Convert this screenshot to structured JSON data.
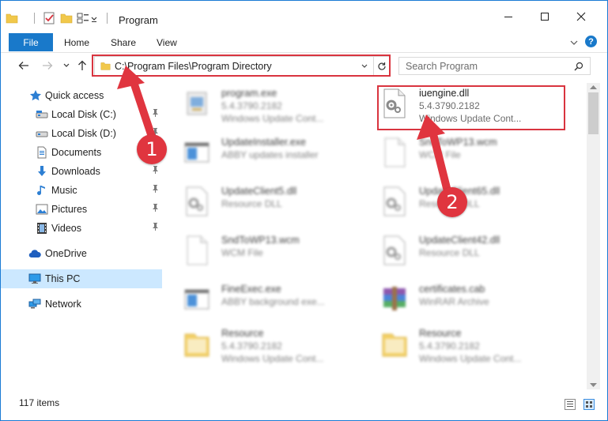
{
  "window": {
    "title": "Program",
    "minimize_glyph": "─",
    "maximize_glyph": "☐",
    "close_glyph": "✕"
  },
  "ribbon": {
    "tabs": [
      "File",
      "Home",
      "Share",
      "View"
    ],
    "expand_glyph": "⌄",
    "help_glyph": "?"
  },
  "nav": {
    "back_glyph": "←",
    "forward_glyph": "→",
    "recent_glyph": "⌄",
    "up_glyph": "↑"
  },
  "address": {
    "path": "C:\\Program Files\\Program Directory",
    "dropdown_glyph": "⌄",
    "refresh_glyph": "↻"
  },
  "search": {
    "placeholder": "Search Program",
    "icon_glyph": "⚲"
  },
  "sidebar": {
    "items": [
      {
        "label": "Quick access",
        "icon": "star-icon",
        "pinned": false
      },
      {
        "label": "Local Disk (C:)",
        "icon": "drive-icon",
        "pinned": true
      },
      {
        "label": "Local Disk (D:)",
        "icon": "drive-icon",
        "pinned": true
      },
      {
        "label": "Documents",
        "icon": "documents-icon",
        "pinned": true
      },
      {
        "label": "Downloads",
        "icon": "download-icon",
        "pinned": true
      },
      {
        "label": "Music",
        "icon": "music-icon",
        "pinned": true
      },
      {
        "label": "Pictures",
        "icon": "pictures-icon",
        "pinned": true
      },
      {
        "label": "Videos",
        "icon": "videos-icon",
        "pinned": true
      },
      {
        "label": "OneDrive",
        "icon": "cloud-icon",
        "pinned": false
      },
      {
        "label": "This PC",
        "icon": "computer-icon",
        "pinned": false,
        "selected": true
      },
      {
        "label": "Network",
        "icon": "network-icon",
        "pinned": false
      }
    ],
    "pin_glyph": "📌"
  },
  "files": [
    {
      "name": "program.exe",
      "line2": "5.4.3790.2182",
      "line3": "Windows Update Cont...",
      "icon": "installer-icon",
      "blurred": true
    },
    {
      "name": "iuengine.dll",
      "line2": "5.4.3790.2182",
      "line3": "Windows Update Cont...",
      "icon": "dll-gear-icon",
      "blurred": false,
      "highlighted": true
    },
    {
      "name": "UpdateInstaller.exe",
      "line2": "ABBY updates installer",
      "line3": "",
      "icon": "app-window-icon",
      "blurred": true
    },
    {
      "name": "SndToWP13.wcm",
      "line2": "WCM File",
      "line3": "",
      "icon": "blank-file-icon",
      "blurred": true
    },
    {
      "name": "UpdateClient5.dll",
      "line2": "Resource DLL",
      "line3": "",
      "icon": "dll-gear-icon",
      "blurred": true
    },
    {
      "name": "UpdateClient65.dll",
      "line2": "Resource DLL",
      "line3": "",
      "icon": "dll-gear-icon",
      "blurred": true
    },
    {
      "name": "SndToWP13.wcm",
      "line2": "WCM File",
      "line3": "",
      "icon": "blank-file-icon",
      "blurred": true
    },
    {
      "name": "UpdateClient42.dll",
      "line2": "Resource DLL",
      "line3": "",
      "icon": "dll-gear-icon",
      "blurred": true
    },
    {
      "name": "FineExec.exe",
      "line2": "ABBY background exe...",
      "line3": "",
      "icon": "app-window-icon",
      "blurred": true
    },
    {
      "name": "certificates.cab",
      "line2": "WinRAR Archive",
      "line3": "",
      "icon": "winrar-archive-icon",
      "blurred": true
    },
    {
      "name": "Resource",
      "line2": "5.4.3790.2182",
      "line3": "Windows Update Cont...",
      "icon": "folder-icon",
      "blurred": true
    },
    {
      "name": "Resource",
      "line2": "5.4.3790.2182",
      "line3": "Windows Update Cont...",
      "icon": "folder-icon",
      "blurred": true
    }
  ],
  "status": {
    "item_count": "117 items"
  },
  "annotations": {
    "badge1": "1",
    "badge2": "2",
    "color": "#e0353f"
  },
  "colors": {
    "accent": "#1979ca",
    "selection": "#cce8ff",
    "highlight_box": "#d9343f"
  }
}
